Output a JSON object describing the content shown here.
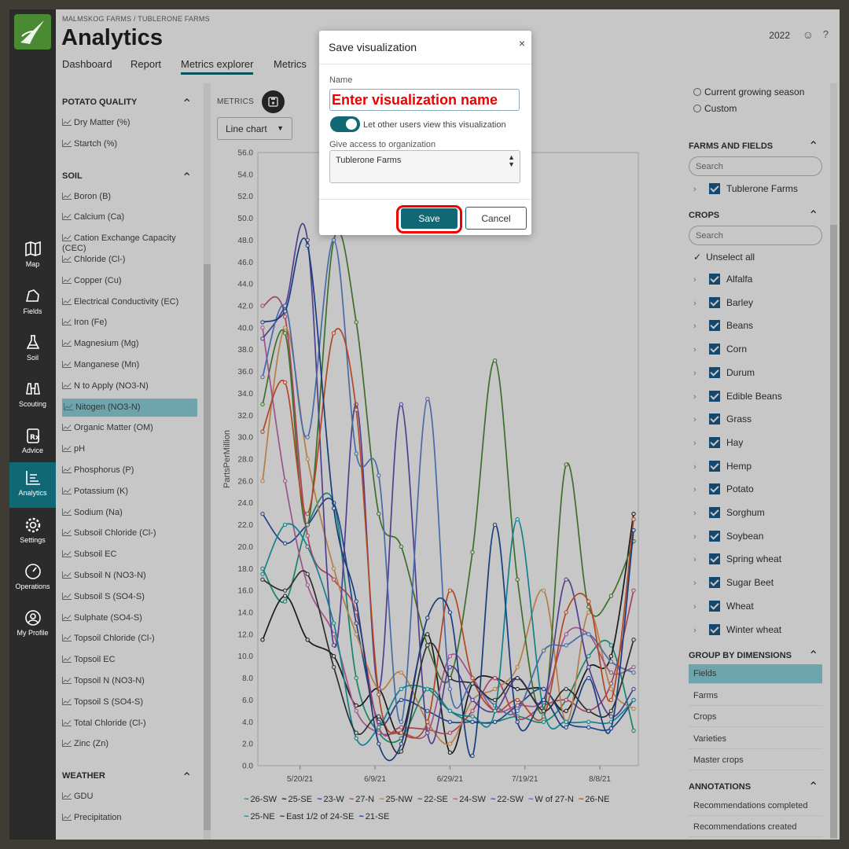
{
  "header": {
    "breadcrumb": "MALMSKOG FARMS / TUBLERONE FARMS",
    "title": "Analytics",
    "tabs": [
      "Dashboard",
      "Report",
      "Metrics explorer",
      "Metrics"
    ],
    "active_tab": "Metrics explorer",
    "year": "2022"
  },
  "nav": {
    "items": [
      {
        "label": "Map",
        "icon": "map-icon"
      },
      {
        "label": "Fields",
        "icon": "fields-icon"
      },
      {
        "label": "Soil",
        "icon": "flask-icon"
      },
      {
        "label": "Scouting",
        "icon": "binoculars-icon"
      },
      {
        "label": "Advice",
        "icon": "rx-icon"
      },
      {
        "label": "Analytics",
        "icon": "analytics-icon"
      },
      {
        "label": "Settings",
        "icon": "gear-icon"
      },
      {
        "label": "Operations",
        "icon": "gauge-icon"
      },
      {
        "label": "My Profile",
        "icon": "profile-icon"
      }
    ],
    "active": "Analytics"
  },
  "left_panel": {
    "sections": [
      {
        "title": "POTATO QUALITY",
        "items": [
          "Dry Matter (%)",
          "Startch (%)"
        ]
      },
      {
        "title": "SOIL",
        "items": [
          "Boron (B)",
          "Calcium (Ca)",
          "Cation Exchange Capacity (CEC)",
          "Chloride (Cl-)",
          "Copper (Cu)",
          "Electrical Conductivity (EC)",
          "Iron (Fe)",
          "Magnesium (Mg)",
          "Manganese (Mn)",
          "N to Apply (NO3-N)",
          "Nitogen (NO3-N)",
          "Organic Matter (OM)",
          "pH",
          "Phosphorus (P)",
          "Potassium (K)",
          "Sodium (Na)",
          "Subsoil Chloride (Cl-)",
          "Subsoil EC",
          "Subsoil N (NO3-N)",
          "Subsoil S (SO4-S)",
          "Sulphate (SO4-S)",
          "Topsoil Chloride (Cl-)",
          "Topsoil EC",
          "Topsoil N (NO3-N)",
          "Topsoil S (SO4-S)",
          "Total Chloride (Cl-)",
          "Zinc (Zn)"
        ]
      },
      {
        "title": "WEATHER",
        "items": [
          "GDU",
          "Precipitation"
        ]
      }
    ],
    "selected": "Nitogen (NO3-N)"
  },
  "center": {
    "metrics_label": "METRICS",
    "chart_type_select": "Line chart"
  },
  "chart_data": {
    "type": "line",
    "ylabel": "PartsPerMillion",
    "xlabel": "",
    "ylim": [
      0,
      56
    ],
    "yticks": [
      "0.0",
      "2.0",
      "4.0",
      "6.0",
      "8.0",
      "10.0",
      "12.0",
      "14.0",
      "16.0",
      "18.0",
      "20.0",
      "22.0",
      "24.0",
      "26.0",
      "28.0",
      "30.0",
      "32.0",
      "34.0",
      "36.0",
      "38.0",
      "40.0",
      "42.0",
      "44.0",
      "46.0",
      "48.0",
      "50.0",
      "52.0",
      "54.0",
      "56.0"
    ],
    "xticks": [
      {
        "label": "5/20/21",
        "day": 10
      },
      {
        "label": "6/9/21",
        "day": 30
      },
      {
        "label": "6/29/21",
        "day": 50
      },
      {
        "label": "7/19/21",
        "day": 70
      },
      {
        "label": "8/8/21",
        "day": 90
      }
    ],
    "x_days": [
      0,
      6,
      12,
      19,
      25,
      31,
      37,
      44,
      50,
      56,
      62,
      68,
      75,
      81,
      87,
      93,
      99
    ],
    "series": [
      {
        "name": "26-SW",
        "color": "#1fa88a",
        "values": [
          18,
          15,
          22,
          24,
          8,
          3,
          2.5,
          7,
          5,
          4,
          4,
          4.5,
          4,
          6,
          10,
          11,
          3.2
        ]
      },
      {
        "name": "25-SE",
        "color": "#222222",
        "values": [
          11.5,
          15.5,
          11.5,
          10,
          5.5,
          7,
          3,
          12,
          1.2,
          7.5,
          8,
          7,
          7,
          5,
          9,
          10,
          23
        ]
      },
      {
        "name": "23-W",
        "color": "#2d57b0",
        "values": [
          23,
          20.3,
          22,
          24,
          13,
          4,
          6,
          5,
          4,
          4,
          4,
          5.5,
          7,
          4,
          3.5,
          3.4,
          6
        ]
      },
      {
        "name": "27-N",
        "color": "#d2557b",
        "values": [
          42,
          41,
          21,
          17,
          14,
          3.5,
          3.5,
          3.3,
          3,
          5,
          8,
          4.3,
          5.5,
          6,
          5,
          7.5,
          16
        ]
      },
      {
        "name": "25-NW",
        "color": "#e8a055",
        "values": [
          26,
          40,
          28,
          18,
          12,
          7,
          8.5,
          4,
          2,
          6,
          7,
          9,
          16,
          4,
          14,
          7,
          5.2
        ]
      },
      {
        "name": "22-SE",
        "color": "#4f8f38",
        "values": [
          33,
          39.5,
          22,
          48,
          40.5,
          23,
          20,
          11,
          8,
          19.5,
          37,
          17,
          5,
          27.5,
          14.5,
          15.5,
          20.5
        ]
      },
      {
        "name": "24-SW",
        "color": "#c96bb5",
        "values": [
          40,
          26,
          16.5,
          12,
          5,
          3,
          3,
          3,
          10,
          8,
          5,
          5.5,
          6,
          12,
          12,
          8.5,
          9
        ]
      },
      {
        "name": "22-SW",
        "color": "#6a50b8",
        "values": [
          39,
          42,
          48,
          11,
          33,
          7,
          33,
          3,
          9,
          6,
          5,
          8,
          6,
          17,
          9,
          4.5,
          7
        ]
      },
      {
        "name": "W of 27-N",
        "color": "#5b89d6",
        "values": [
          35.5,
          42,
          30,
          48,
          28.5,
          26.5,
          4,
          33.5,
          7,
          7.5,
          5.5,
          5,
          10.5,
          11,
          12,
          9.5,
          8.5
        ]
      },
      {
        "name": "26-NE",
        "color": "#e35b2d",
        "values": [
          30.5,
          35,
          23,
          39.5,
          32.5,
          6.5,
          3,
          4,
          16,
          8,
          5,
          6,
          4.5,
          14,
          15,
          6,
          22.5
        ]
      },
      {
        "name": "25-NE",
        "color": "#17a7b5",
        "values": [
          17.5,
          22,
          20,
          13,
          2.5,
          3.5,
          7,
          7,
          5,
          4.5,
          5,
          22.5,
          5,
          4,
          4,
          4,
          6
        ]
      },
      {
        "name": "East 1/2 of 24-SE",
        "color": "#3b3b3b",
        "values": [
          17,
          16,
          17.5,
          9,
          3,
          4.5,
          1.3,
          11,
          8,
          7.5,
          6,
          8,
          5,
          7,
          5,
          5,
          11.5
        ]
      },
      {
        "name": "21-SE",
        "color": "#1f4fa2",
        "values": [
          40.5,
          41.5,
          47.5,
          23.5,
          15,
          2,
          2,
          13.5,
          14,
          0.9,
          22,
          4,
          6,
          3.5,
          8,
          3.4,
          21.5
        ]
      }
    ]
  },
  "right_panel": {
    "radios": [
      "Current growing season",
      "Custom"
    ],
    "farms_title": "FARMS AND FIELDS",
    "search_placeholder": "Search",
    "farm": "Tublerone Farms",
    "crops_title": "CROPS",
    "crops_search_placeholder": "Search",
    "unselect_all": "Unselect all",
    "crops": [
      "Alfalfa",
      "Barley",
      "Beans",
      "Corn",
      "Durum",
      "Edible Beans",
      "Grass",
      "Hay",
      "Hemp",
      "Potato",
      "Sorghum",
      "Soybean",
      "Spring wheat",
      "Sugar Beet",
      "Wheat",
      "Winter wheat"
    ],
    "group_title": "GROUP BY DIMENSIONS",
    "dimensions": [
      "Fields",
      "Farms",
      "Crops",
      "Varieties",
      "Master crops"
    ],
    "dimension_selected": "Fields",
    "annotations_title": "ANNOTATIONS",
    "annotations": [
      "Recommendations completed",
      "Recommendations created"
    ]
  },
  "modal": {
    "title": "Save visualization",
    "name_label": "Name",
    "name_value": "Enter visualization name",
    "toggle_label": "Let other users view this visualization",
    "org_label": "Give access to organization",
    "org_value": "Tublerone Farms",
    "save_label": "Save",
    "cancel_label": "Cancel",
    "close_glyph": "×"
  }
}
